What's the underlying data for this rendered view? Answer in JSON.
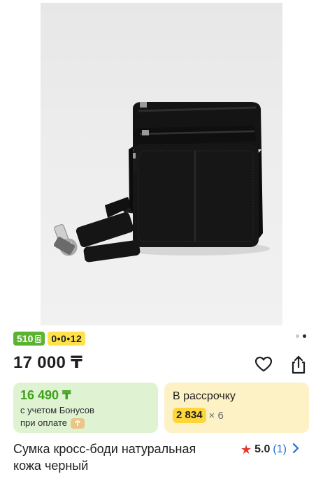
{
  "photo": {
    "alt": "Сумка кросс-боди натуральная кожа черный"
  },
  "badges": {
    "bonus": "510",
    "bonus_icon": "Б",
    "installment": "0•0•12"
  },
  "carousel": {
    "pages": 2,
    "active": 2
  },
  "product": {
    "price": "17 000 ₸",
    "title_line1": "Сумка кросс-боди натуральная",
    "title_line2": "кожа черный",
    "rating": "5.0",
    "reviews": "(1)"
  },
  "bonus_card": {
    "price": "16 490 ₸",
    "line1": "с учетом Бонусов",
    "line2": "при оплате"
  },
  "installment_card": {
    "title": "В рассрочку",
    "amount": "2 834",
    "multiplier": "× 6"
  },
  "colors": {
    "bonus_green": "#5bb331",
    "installment_yellow": "#ffe14a",
    "bonus_card_bg": "#dff3d3",
    "installment_card_bg": "#fdf2c6",
    "link_blue": "#1f6fd6",
    "star_red": "#e5372f"
  },
  "icons": [
    "favorite-heart-icon",
    "share-icon",
    "star-icon",
    "chevron-right-icon",
    "kaspi-pay-icon"
  ]
}
